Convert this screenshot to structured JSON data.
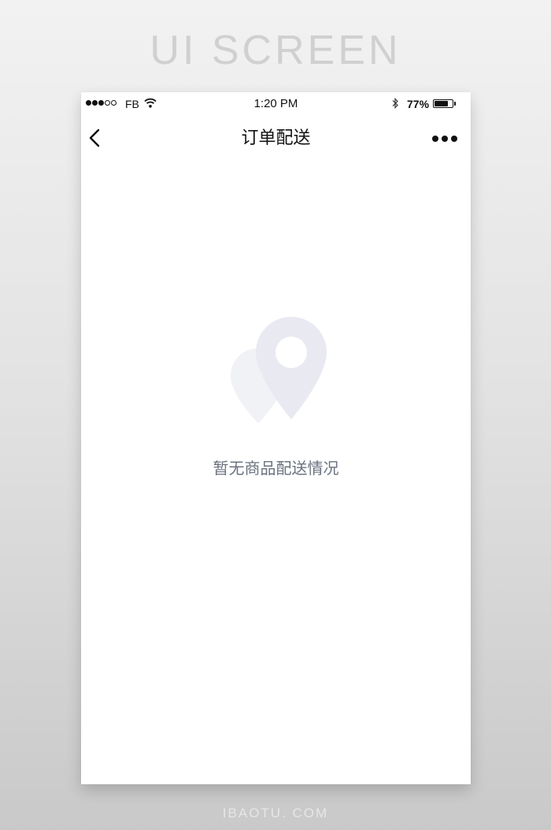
{
  "banner": {
    "title": "UI SCREEN"
  },
  "status_bar": {
    "carrier": "FB",
    "time": "1:20 PM",
    "battery_percent": "77%",
    "battery_level": 0.77,
    "signal_bars_filled": 3,
    "signal_bars_total": 5
  },
  "nav": {
    "title": "订单配送",
    "back_icon": "chevron-left-icon",
    "more_icon": "more-horizontal-icon"
  },
  "empty_state": {
    "icon": "location-pin-icon",
    "message": "暂无商品配送情况"
  },
  "footer": {
    "text": "IBAOTU. COM"
  },
  "colors": {
    "icon_tint": "#e8e9f1",
    "message_text": "#6b7180",
    "nav_text": "#111111"
  }
}
